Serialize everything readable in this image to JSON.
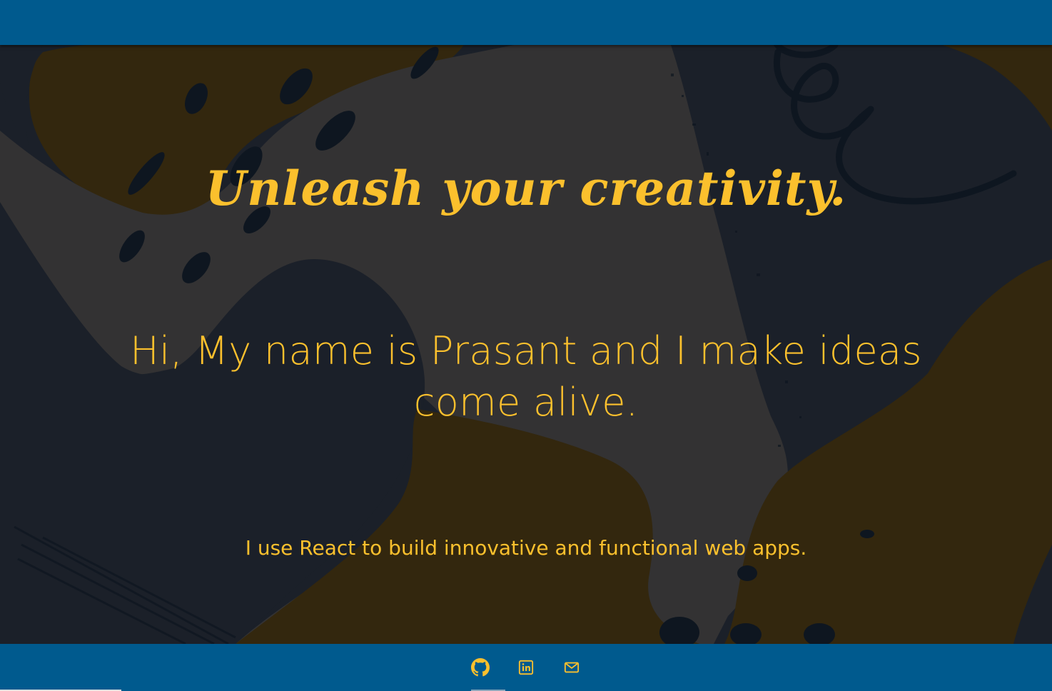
{
  "hero": {
    "tagline": "Unleash your creativity.",
    "headline": "Hi, My name is Prasant and I make ideas come alive.",
    "subline": "I use React to build innovative and functional web apps."
  },
  "footer": {
    "links": [
      {
        "icon": "github-icon",
        "label": "GitHub"
      },
      {
        "icon": "linkedin-icon",
        "label": "LinkedIn"
      },
      {
        "icon": "mail-icon",
        "label": "Email"
      }
    ]
  },
  "colors": {
    "bar": "#005a8e",
    "accent": "#fbc02d",
    "background": "#1b2029",
    "gray_shape": "#333233",
    "mustard_shape": "#33270e",
    "ink": "#0e1620"
  }
}
